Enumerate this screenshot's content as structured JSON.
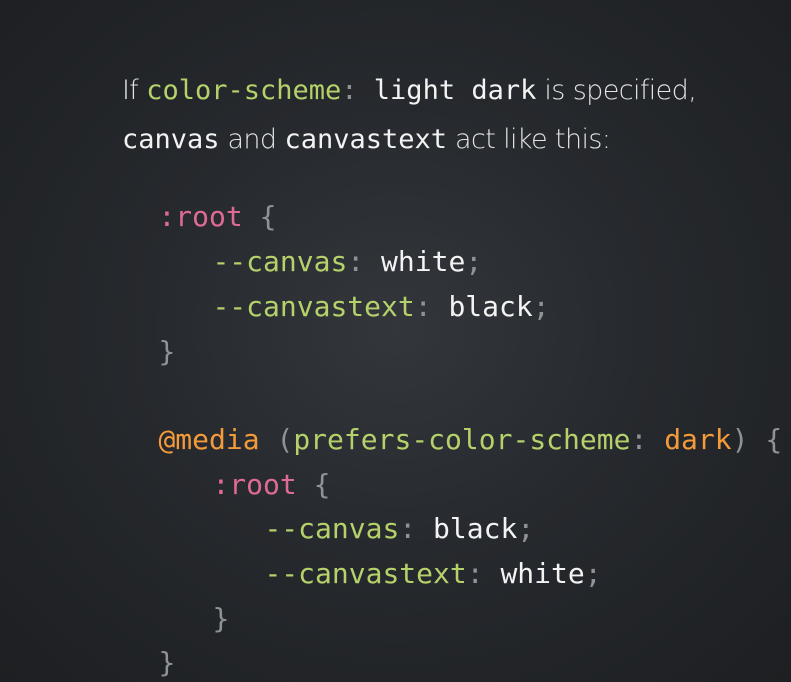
{
  "intro": {
    "line1": {
      "t1": "If ",
      "code1": "color-scheme",
      "colon": ": ",
      "code2": "light dark",
      "t2": " is specified,"
    },
    "line2": {
      "code1": "canvas",
      "t1": " and ",
      "code2": "canvastext",
      "t2": " act like this:"
    }
  },
  "code_block_1": {
    "selector": ":root",
    "open_brace": "{",
    "decl1": {
      "prop": "--canvas",
      "colon": ":",
      "value": "white",
      "semi": ";"
    },
    "decl2": {
      "prop": "--canvastext",
      "colon": ":",
      "value": "black",
      "semi": ";"
    },
    "close_brace": "}"
  },
  "code_block_2": {
    "at_rule": "@media",
    "open_paren": "(",
    "feature": "prefers-color-scheme",
    "colon": ":",
    "feature_value": "dark",
    "close_paren": ")",
    "open_brace": "{",
    "inner_selector": ":root",
    "inner_open_brace": "{",
    "decl1": {
      "prop": "--canvas",
      "colon": ":",
      "value": "black",
      "semi": ";"
    },
    "decl2": {
      "prop": "--canvastext",
      "colon": ":",
      "value": "white",
      "semi": ";"
    },
    "inner_close_brace": "}",
    "close_brace": "}"
  },
  "colors": {
    "background": "#26292d",
    "property_green": "#b5d26a",
    "selector_pink": "#de6a95",
    "at_rule_orange": "#f49a3a",
    "punctuation_gray": "#8f9296",
    "text_white": "#f3f3f3"
  }
}
